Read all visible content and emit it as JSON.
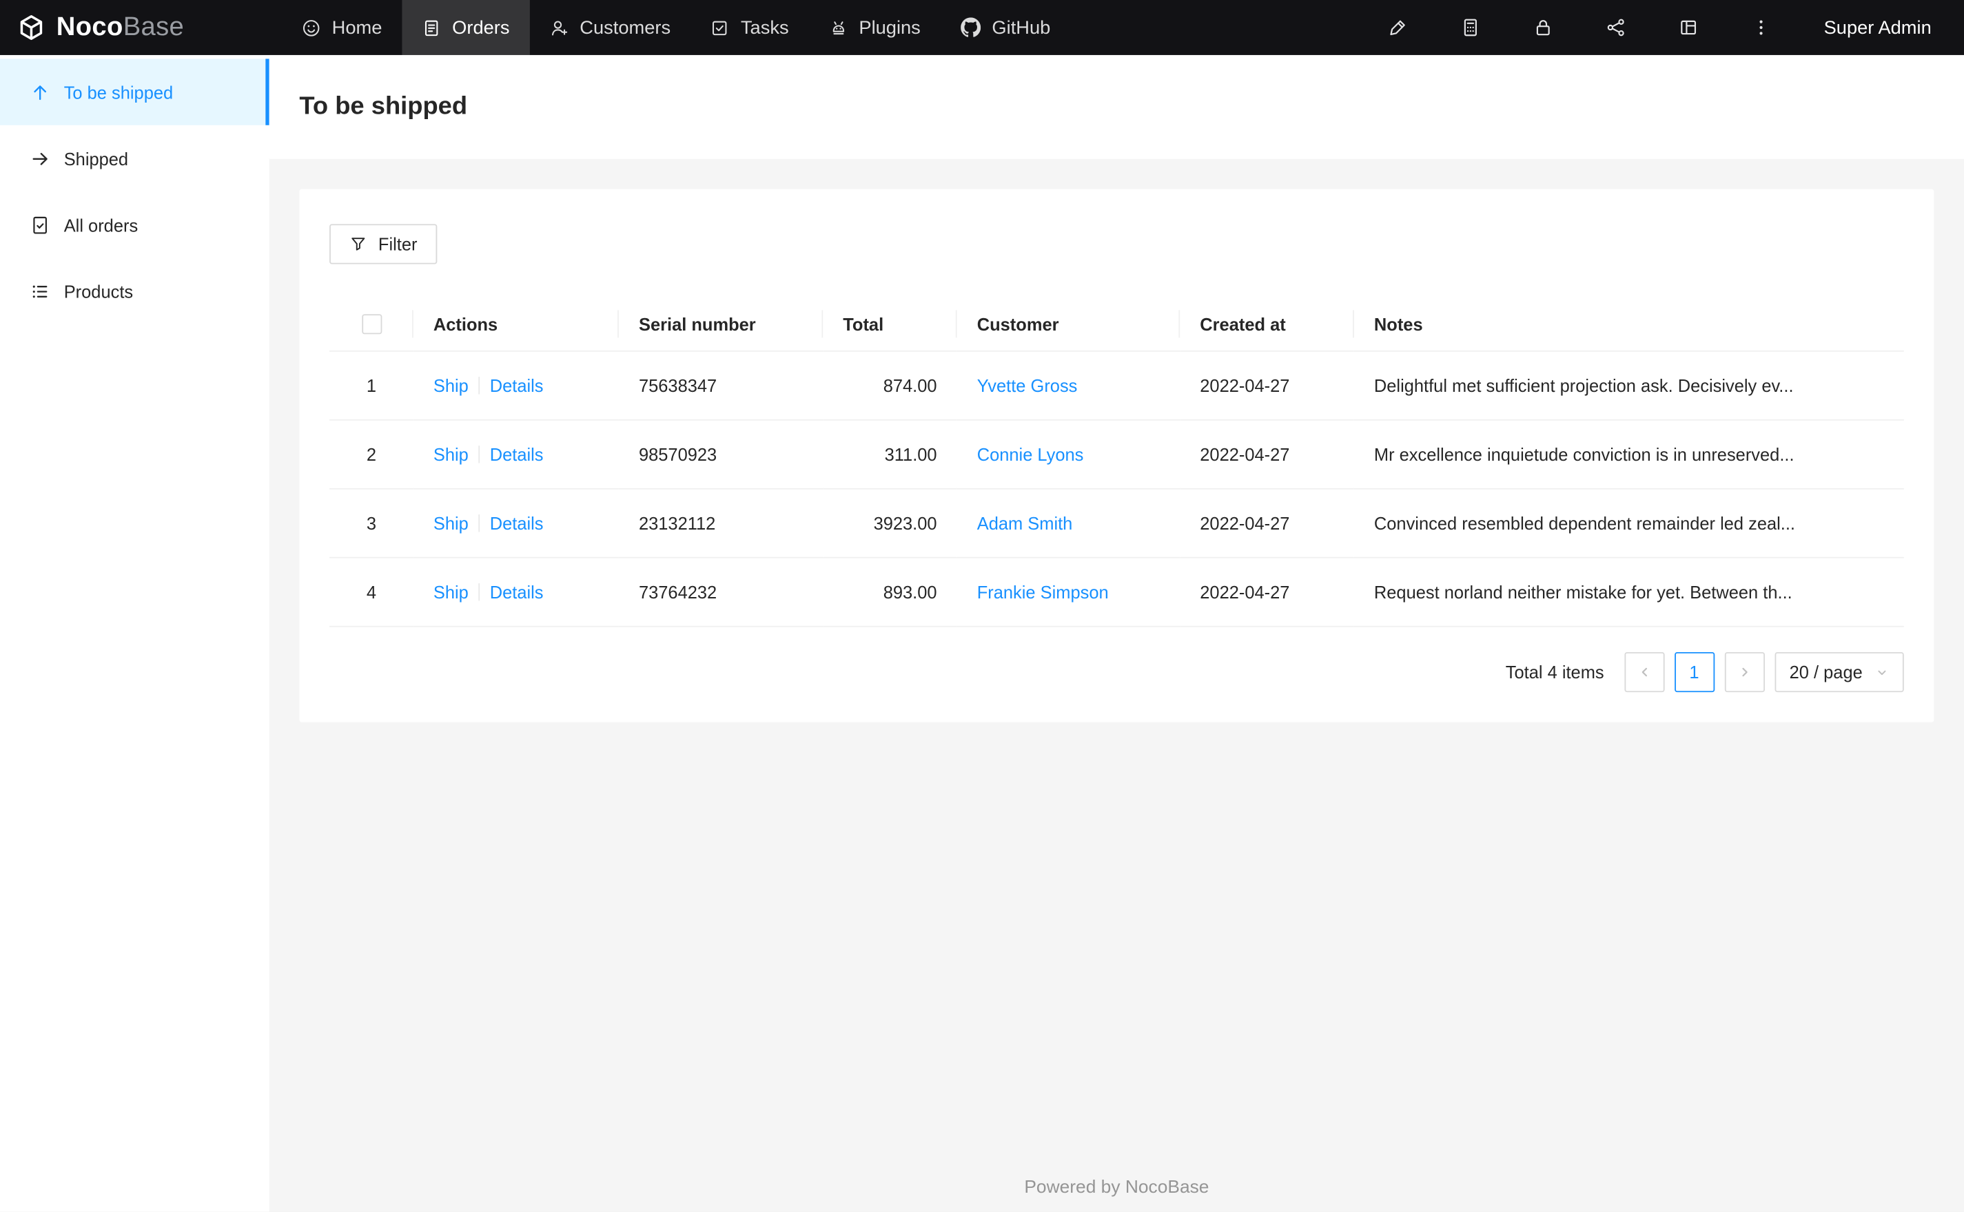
{
  "brand": {
    "bold": "Noco",
    "light": "Base"
  },
  "navbar": {
    "items": [
      {
        "label": "Home",
        "icon": "smile-icon"
      },
      {
        "label": "Orders",
        "icon": "orders-icon",
        "active": true
      },
      {
        "label": "Customers",
        "icon": "customers-icon"
      },
      {
        "label": "Tasks",
        "icon": "tasks-icon"
      },
      {
        "label": "Plugins",
        "icon": "plugins-icon"
      },
      {
        "label": "GitHub",
        "icon": "github-icon"
      }
    ],
    "tool_icons": [
      "highlight-icon",
      "calculator-icon",
      "lock-icon",
      "share-icon",
      "layout-icon",
      "more-icon"
    ],
    "user": "Super Admin"
  },
  "sidebar": {
    "items": [
      {
        "label": "To be shipped",
        "icon": "arrow-up-icon",
        "active": true
      },
      {
        "label": "Shipped",
        "icon": "arrow-right-icon"
      },
      {
        "label": "All orders",
        "icon": "file-check-icon"
      },
      {
        "label": "Products",
        "icon": "list-icon"
      }
    ]
  },
  "page": {
    "title": "To be shipped"
  },
  "toolbar": {
    "filter_label": "Filter"
  },
  "table": {
    "headers": {
      "actions": "Actions",
      "serial": "Serial number",
      "total": "Total",
      "customer": "Customer",
      "created": "Created at",
      "notes": "Notes"
    },
    "rows": [
      {
        "index": "1",
        "ship": "Ship",
        "details": "Details",
        "serial": "75638347",
        "total": "874.00",
        "customer": "Yvette Gross",
        "created": "2022-04-27",
        "notes": "Delightful met sufficient projection ask. Decisively ev..."
      },
      {
        "index": "2",
        "ship": "Ship",
        "details": "Details",
        "serial": "98570923",
        "total": "311.00",
        "customer": "Connie Lyons",
        "created": "2022-04-27",
        "notes": "Mr excellence inquietude conviction is in unreserved..."
      },
      {
        "index": "3",
        "ship": "Ship",
        "details": "Details",
        "serial": "23132112",
        "total": "3923.00",
        "customer": "Adam Smith",
        "created": "2022-04-27",
        "notes": "Convinced resembled dependent remainder led zeal..."
      },
      {
        "index": "4",
        "ship": "Ship",
        "details": "Details",
        "serial": "73764232",
        "total": "893.00",
        "customer": "Frankie Simpson",
        "created": "2022-04-27",
        "notes": "Request norland neither mistake for yet. Between th..."
      }
    ]
  },
  "pagination": {
    "total_text": "Total 4 items",
    "current_page": "1",
    "page_size": "20 / page"
  },
  "footer": {
    "text": "Powered by NocoBase"
  },
  "colors": {
    "accent": "#1890ff",
    "accent_light": "#e6f7ff",
    "navbar_bg": "#121215",
    "content_bg": "#f5f5f5"
  }
}
